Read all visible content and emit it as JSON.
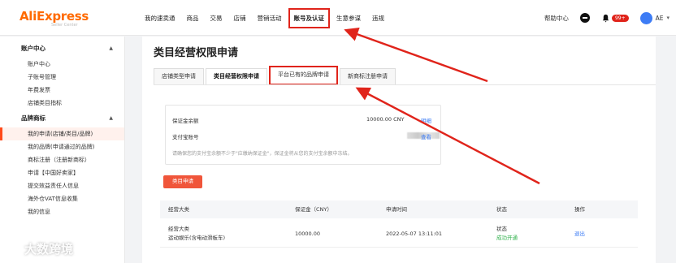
{
  "brand": {
    "logo_text": "AliExpress",
    "logo_sub": "Seller Center"
  },
  "nav": [
    {
      "label": "我的速卖通",
      "name": "nav-my-aliexpress",
      "highlight": false
    },
    {
      "label": "商品",
      "name": "nav-products",
      "highlight": false
    },
    {
      "label": "交易",
      "name": "nav-trade",
      "highlight": false
    },
    {
      "label": "店铺",
      "name": "nav-store",
      "highlight": false
    },
    {
      "label": "营销活动",
      "name": "nav-marketing",
      "highlight": false
    },
    {
      "label": "账号及认证",
      "name": "nav-account-certification",
      "highlight": true
    },
    {
      "label": "生意参谋",
      "name": "nav-business-advisor",
      "highlight": false
    },
    {
      "label": "违规",
      "name": "nav-violations",
      "highlight": false
    }
  ],
  "header_right": {
    "help": "帮助中心",
    "badge": "99+",
    "account": "AE"
  },
  "sidebar": {
    "groups": [
      {
        "title": "账户中心",
        "items": [
          "账户中心",
          "子账号管理",
          "年费发票",
          "店铺类目指标"
        ]
      },
      {
        "title": "品牌商标",
        "items": [
          "我的申请(店铺/类目/品牌)",
          "我的品牌(申请通过的品牌)",
          "商标注册（注册新商标）",
          "申请【中国好卖家】",
          "提交效益责任人信息",
          "海外仓VAT信息收集",
          "我的信息"
        ]
      }
    ],
    "active_item": "我的申请(店铺/类目/品牌)"
  },
  "page": {
    "title": "类目经营权限申请",
    "tabs": [
      {
        "label": "店铺类型申请",
        "active": false,
        "highlight": false
      },
      {
        "label": "类目经营权限申请",
        "active": true,
        "highlight": false
      },
      {
        "label": "平台已有的品牌申请",
        "active": false,
        "highlight": true
      },
      {
        "label": "新商标注册申请",
        "active": false,
        "highlight": false
      }
    ]
  },
  "deposit": {
    "balance_label": "保证金余额",
    "balance_value": "10000.00 CNY",
    "balance_link": "明细",
    "alipay_label": "支付宝账号",
    "alipay_link": "查看",
    "note": "请确保您的支付宝余额不少于\"应缴纳保证金\"，保证金将从您的支付宝余额中冻结。"
  },
  "apply_button": "类目申请",
  "table": {
    "headers": [
      "经营大类",
      "保证金（CNY）",
      "申请时间",
      "状态",
      "操作"
    ],
    "rows": [
      {
        "category_line1": "经营大类",
        "category_line2": "运动娱乐(含电动滑板车)",
        "deposit": "10000.00",
        "time": "2022-05-07 13:11:01",
        "status_line1": "状态",
        "status_line2": "成功开通",
        "action": "退出"
      }
    ]
  },
  "watermark": "大数跨境",
  "colors": {
    "brand": "#ff6a00",
    "highlight": "#e0241b",
    "primary_button": "#f0553a",
    "link": "#3d7cf5",
    "success": "#2fb14b",
    "active_bg": "#fff1ed"
  }
}
